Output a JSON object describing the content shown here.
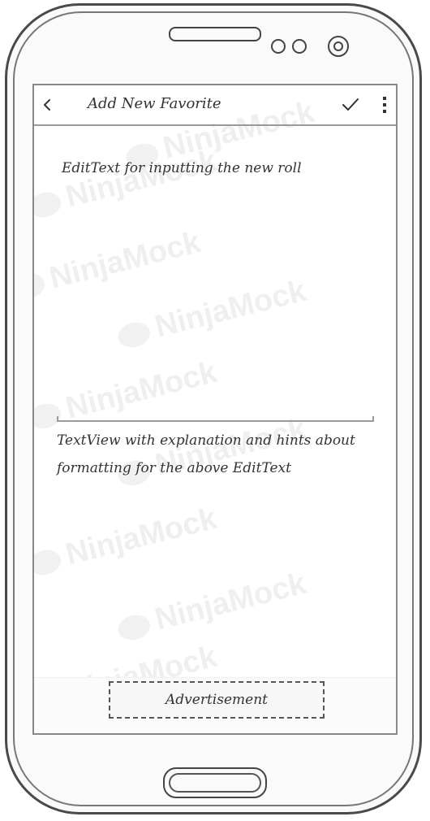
{
  "action_bar": {
    "title": "Add New Favorite",
    "back_icon": "chevron-left-icon",
    "confirm_icon": "checkmark-icon",
    "overflow_icon": "vertical-dots-icon"
  },
  "edit_text": {
    "label": "EditText for inputting the new roll"
  },
  "help_text": {
    "line1": "TextView with explanation and hints about",
    "line2": "formatting for the above EditText"
  },
  "ad": {
    "label": "Advertisement"
  },
  "watermark": {
    "text": "NinjaMock"
  }
}
